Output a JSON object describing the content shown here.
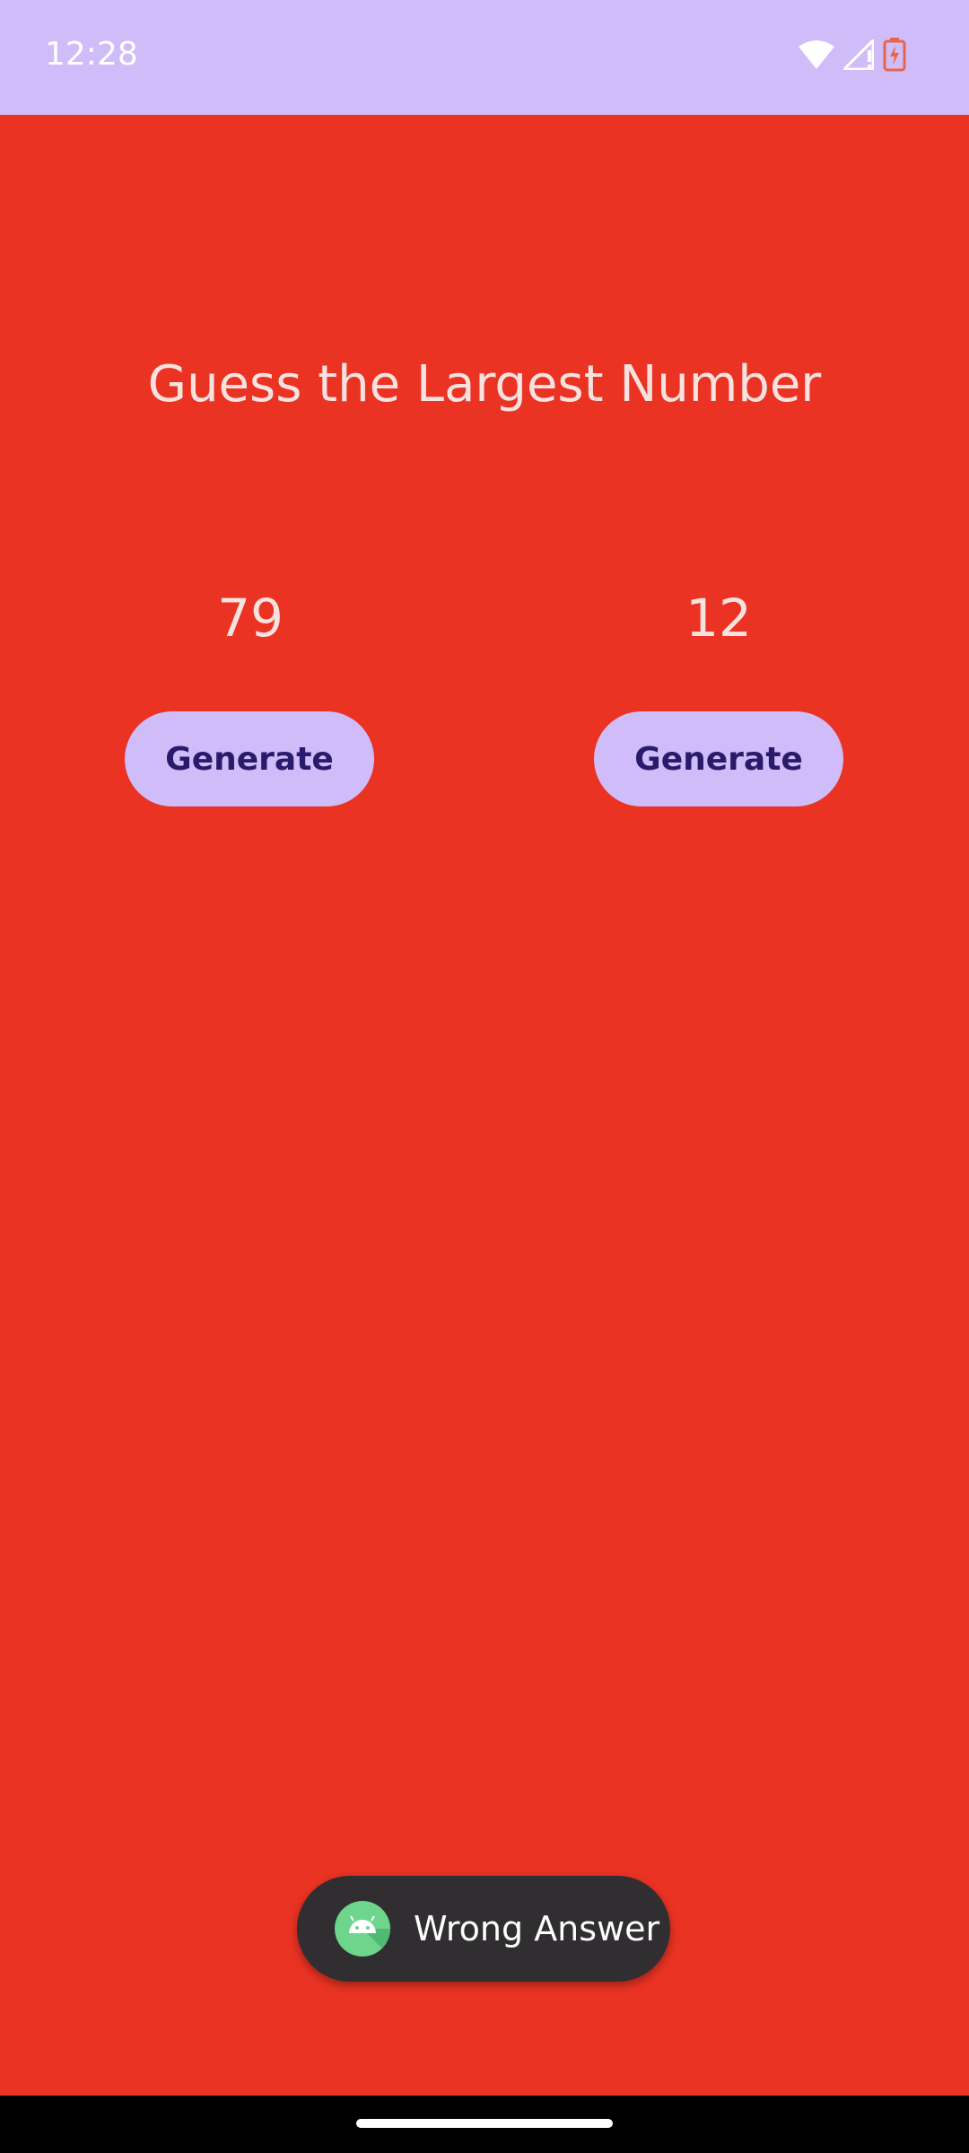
{
  "status_bar": {
    "time": "12:28",
    "icons": [
      "wifi-icon",
      "signal-icon",
      "battery-charging-icon"
    ]
  },
  "main": {
    "title": "Guess the Largest Number",
    "left": {
      "number": "79",
      "button_label": "Generate"
    },
    "right": {
      "number": "12",
      "button_label": "Generate"
    }
  },
  "toast": {
    "icon": "android-icon",
    "message": "Wrong Answer"
  },
  "colors": {
    "background": "#EA3323",
    "status_bar": "#CFBCF9",
    "button": "#CFBCF9",
    "button_text": "#2A1A6B",
    "toast": "#302E30",
    "battery": "#E8654A"
  }
}
